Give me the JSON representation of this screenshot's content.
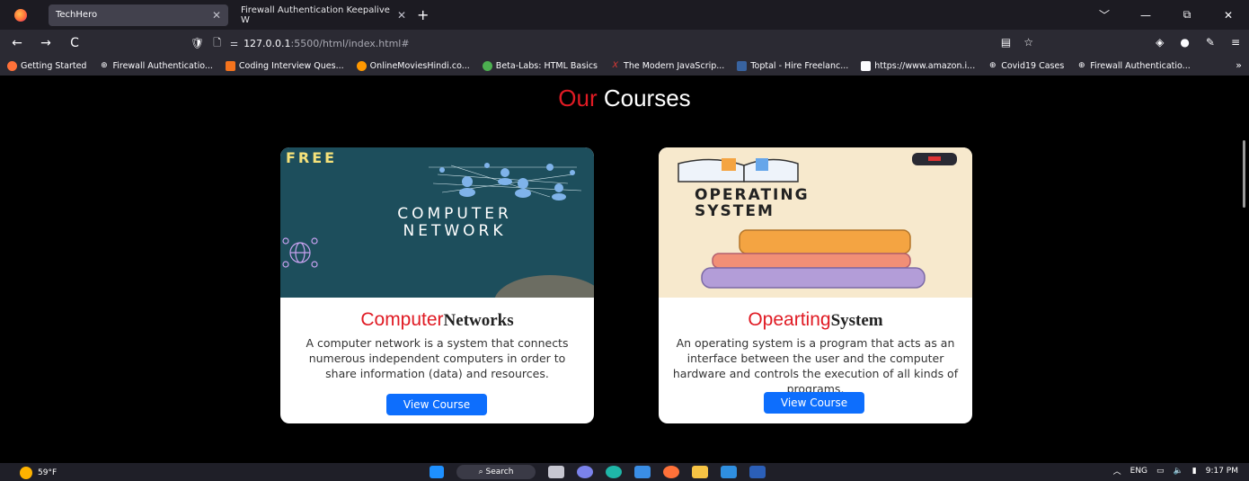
{
  "browser": {
    "tabs": [
      {
        "label": "TechHero",
        "active": true
      },
      {
        "label": "Firewall Authentication Keepalive W",
        "active": false
      }
    ],
    "new_tab": "+",
    "window_controls": {
      "list": "﹀",
      "minimize": "—",
      "restore": "⧉",
      "close": "✕"
    },
    "nav": {
      "back": "←",
      "forward": "→",
      "reload": "C"
    },
    "url": {
      "host": "127.0.0.1",
      "path": ":5500/html/index.html#"
    },
    "bookmarks": [
      {
        "label": "Getting Started",
        "icon": "firefox-icon",
        "color": "#ff7139"
      },
      {
        "label": "Firewall Authenticatio...",
        "icon": "globe-icon",
        "color": "#fbfbfe"
      },
      {
        "label": "Coding Interview Ques...",
        "icon": "gfg-icon",
        "color": "#f4731d"
      },
      {
        "label": "OnlineMoviesHindi.co...",
        "icon": "movie-icon",
        "color": "#ff9800"
      },
      {
        "label": "Beta-Labs: HTML Basics",
        "icon": "betalabs-icon",
        "color": "#4caf50"
      },
      {
        "label": "The Modern JavaScrip...",
        "icon": "js-icon",
        "color": "#e53935"
      },
      {
        "label": "Toptal - Hire Freelanc...",
        "icon": "toptal-icon",
        "color": "#3863a0"
      },
      {
        "label": "https://www.amazon.i...",
        "icon": "amazon-icon",
        "color": "#fbfbfe"
      },
      {
        "label": "Covid19 Cases",
        "icon": "globe-icon",
        "color": "#fbfbfe"
      },
      {
        "label": "Firewall Authenticatio...",
        "icon": "globe-icon",
        "color": "#fbfbfe"
      }
    ],
    "bookmarks_more": "»"
  },
  "page": {
    "heading_accent": "Our",
    "heading_rest": " Courses",
    "accent_color": "#e01b24",
    "cards": [
      {
        "image_text": {
          "free": "FREE",
          "line1": "COMPUTER",
          "line2": "NETWORK"
        },
        "title_red": "Computer",
        "title_dark": "Networks",
        "description": "A computer network is a system that connects numerous independent computers in order to share information (data) and resources.",
        "button": "View Course"
      },
      {
        "image_text": {
          "line1": "OPERATING",
          "line2": "SYSTEM"
        },
        "title_red": "Opearting",
        "title_dark": "System",
        "description": "An operating system is a program that acts as an interface between the user and the computer hardware and controls the execution of all kinds of programs.",
        "button": "View Course"
      }
    ]
  },
  "taskbar": {
    "weather": "59°F",
    "search": "Search",
    "tray": {
      "lang": "ENG",
      "time": "9:17 PM"
    }
  }
}
